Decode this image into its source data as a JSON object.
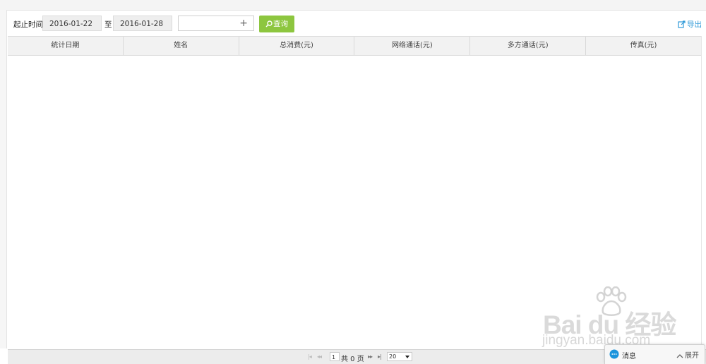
{
  "filter": {
    "label_start_end": "起止时间",
    "start_date": "2016-01-22",
    "separator": "至",
    "end_date": "2016-01-28",
    "add_symbol": "+",
    "search_button": "查询",
    "export_link": "导出"
  },
  "table": {
    "columns": [
      "统计日期",
      "姓名",
      "总消费(元)",
      "网络通话(元)",
      "多方通话(元)",
      "传真(元)"
    ],
    "rows": []
  },
  "pager": {
    "first": "|◂",
    "prev": "◂◂",
    "current_page": "1",
    "total_pages": "共 0 页",
    "next": "▸▸",
    "last": "▸|",
    "page_size": "20"
  },
  "message_panel": {
    "label": "消息",
    "expand": "展开"
  },
  "watermark": {
    "brand": "Bai du 经验",
    "url": "jingyan.baidu.com"
  },
  "colors": {
    "search_button": "#8dc63f",
    "export_link": "#2f9ad8",
    "header_bg": "#f2f2f2",
    "message_icon": "#1a94dc"
  }
}
